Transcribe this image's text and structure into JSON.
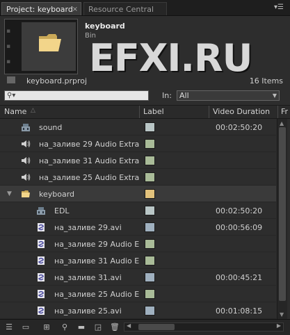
{
  "tabs": {
    "project_label": "Project: keyboard",
    "close_glyph": "×",
    "resource_label": "Resource Central",
    "menu_glyph": "▾☰"
  },
  "preview": {
    "bin_name": "keyboard",
    "bin_type": "Bin",
    "watermark": "EFXI.RU",
    "project_file": "keyboard.prproj",
    "items_count": "16 Items"
  },
  "filter": {
    "search_placeholder": "",
    "search_icon": "search-icon",
    "in_label": "In:",
    "in_value": "All"
  },
  "columns": {
    "name": "Name",
    "label": "Label",
    "video_duration": "Video Duration",
    "next_col": "Fr"
  },
  "rows": [
    {
      "name": "sound",
      "icon": "sequence-icon",
      "label_color": "#b9c6c6",
      "duration": "00:02:50:20",
      "indent": 1
    },
    {
      "name": "на_заливе 29 Audio Extra",
      "icon": "audio-icon",
      "label_color": "#a9bb98",
      "duration": "",
      "indent": 1
    },
    {
      "name": "на_заливе 31 Audio Extra",
      "icon": "audio-icon",
      "label_color": "#a9bb98",
      "duration": "",
      "indent": 1
    },
    {
      "name": "на_заливе 25 Audio Extra",
      "icon": "audio-icon",
      "label_color": "#a9bb98",
      "duration": "",
      "indent": 1
    },
    {
      "name": "keyboard",
      "icon": "folder-icon",
      "label_color": "#e2c27c",
      "duration": "",
      "indent": 0,
      "expanded": true
    },
    {
      "name": "EDL",
      "icon": "sequence-icon",
      "label_color": "#b9c6c6",
      "duration": "00:02:50:20",
      "indent": 2
    },
    {
      "name": "на_заливе 29.avi",
      "icon": "video-file-icon",
      "label_color": "#9fb0bf",
      "duration": "00:00:56:09",
      "indent": 2
    },
    {
      "name": "на_заливе 29 Audio E",
      "icon": "video-file-icon",
      "label_color": "#a9bb98",
      "duration": "",
      "indent": 2
    },
    {
      "name": "на_заливе 31 Audio E",
      "icon": "video-file-icon",
      "label_color": "#a9bb98",
      "duration": "",
      "indent": 2
    },
    {
      "name": "на_заливе 31.avi",
      "icon": "video-file-icon",
      "label_color": "#9fb0bf",
      "duration": "00:00:45:21",
      "indent": 2
    },
    {
      "name": "на_заливе 25 Audio E",
      "icon": "video-file-icon",
      "label_color": "#a9bb98",
      "duration": "",
      "indent": 2
    },
    {
      "name": "на_заливе 25.avi",
      "icon": "video-file-icon",
      "label_color": "#9fb0bf",
      "duration": "00:01:08:15",
      "indent": 2
    }
  ],
  "footer": {
    "icons": [
      "list-view-icon",
      "icon-view-icon",
      "automate-to-sequence-icon",
      "find-icon",
      "new-bin-icon",
      "new-item-icon",
      "clear-icon",
      "scroll-left-icon"
    ]
  },
  "colors": {
    "panel_bg": "#2d2d2d",
    "folder_yellow": "#e2c27c"
  }
}
